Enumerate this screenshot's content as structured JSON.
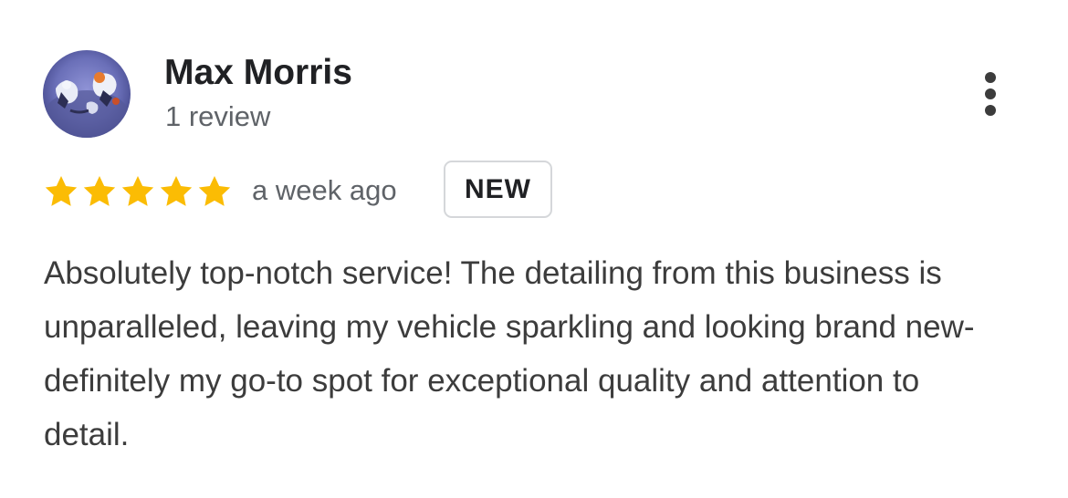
{
  "review": {
    "author": {
      "name": "Max Morris",
      "review_count": "1 review",
      "avatar": "photo-avatar"
    },
    "rating": {
      "value": 5,
      "max": 5,
      "star_color": "#fbbc04"
    },
    "time": "a week ago",
    "badge": "NEW",
    "text": "Absolutely top-notch service! The detailing from this business is unparalleled, leaving my vehicle sparkling and looking brand new- definitely my go-to spot for exceptional quality and attention to detail.",
    "more_icon": "more-vert-icon"
  }
}
